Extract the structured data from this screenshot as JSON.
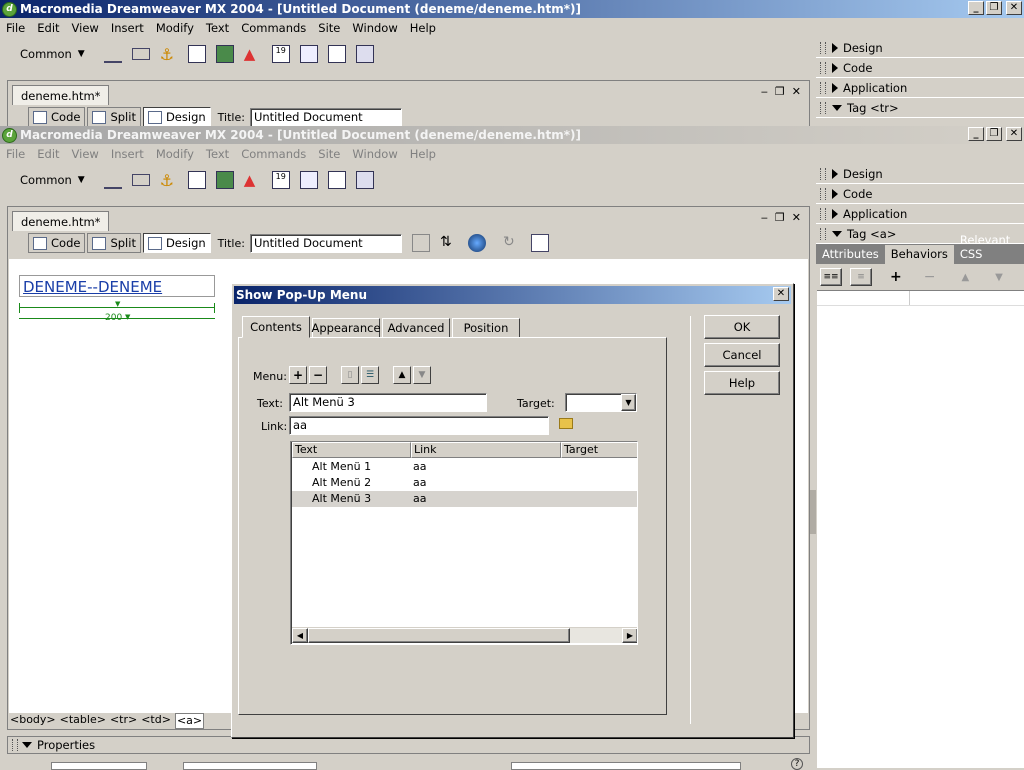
{
  "back_window": {
    "title": "Macromedia Dreamweaver MX 2004 - [Untitled Document (deneme/deneme.htm*)]",
    "menu": [
      "File",
      "Edit",
      "View",
      "Insert",
      "Modify",
      "Text",
      "Commands",
      "Site",
      "Window",
      "Help"
    ],
    "insert_category": "Common",
    "doc_tab": "deneme.htm*",
    "view_buttons": [
      "Code",
      "Split",
      "Design"
    ],
    "title_label": "Title:",
    "title_value": "Untitled Document",
    "panels": [
      "Design",
      "Code",
      "Application",
      "Tag <tr>"
    ]
  },
  "front_window": {
    "title": "Macromedia Dreamweaver MX 2004 - [Untitled Document (deneme/deneme.htm*)]",
    "menu": [
      "File",
      "Edit",
      "View",
      "Insert",
      "Modify",
      "Text",
      "Commands",
      "Site",
      "Window",
      "Help"
    ],
    "insert_category": "Common",
    "doc_tab": "deneme.htm*",
    "view_buttons": [
      "Code",
      "Split",
      "Design"
    ],
    "title_label": "Title:",
    "title_value": "Untitled Document",
    "canvas_link_text": "DENEME--DENEME",
    "table_width_label": "200",
    "tag_selector": [
      "<body>",
      "<table>",
      "<tr>",
      "<td>",
      "<a>"
    ],
    "properties_label": "Properties"
  },
  "right_panels": {
    "groups": [
      "Design",
      "Code",
      "Application",
      "Tag <a>"
    ],
    "tabs": [
      "Attributes",
      "Behaviors",
      "Relevant CSS"
    ],
    "active_tab": "Behaviors"
  },
  "dialog": {
    "title": "Show Pop-Up Menu",
    "tabs": [
      "Contents",
      "Appearance",
      "Advanced",
      "Position"
    ],
    "active_tab": "Contents",
    "menu_label": "Menu:",
    "text_label": "Text:",
    "text_value": "Alt Menü 3",
    "target_label": "Target:",
    "link_label": "Link:",
    "link_value": "aa",
    "columns": [
      "Text",
      "Link",
      "Target"
    ],
    "rows": [
      {
        "text": "Alt Menü 1",
        "link": "aa",
        "target": ""
      },
      {
        "text": "Alt Menü 2",
        "link": "aa",
        "target": ""
      },
      {
        "text": "Alt Menü 3",
        "link": "aa",
        "target": ""
      }
    ],
    "selected_row": 2,
    "ok": "OK",
    "cancel": "Cancel",
    "help": "Help"
  },
  "colors": {
    "active_title": "#0a246a",
    "inactive_title": "#a6a6a6",
    "selection": "#d6d3ce"
  }
}
